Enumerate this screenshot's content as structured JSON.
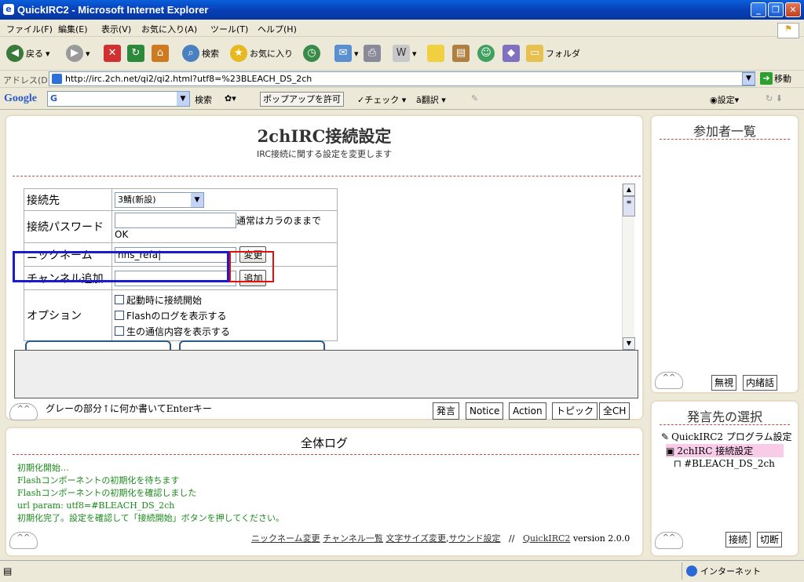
{
  "window": {
    "title": "QuickIRC2 - Microsoft Internet Explorer"
  },
  "menu": [
    "ファイル(F)",
    "編集(E)",
    "表示(V)",
    "お気に入り(A)",
    "ツール(T)",
    "ヘルプ(H)"
  ],
  "toolbar": {
    "back": "戻る",
    "search": "検索",
    "favorites": "お気に入り",
    "folder": "フォルダ"
  },
  "address": {
    "label": "アドレス(D)",
    "url": "http://irc.2ch.net/qi2/qi2.html?utf8=%23BLEACH_DS_2ch",
    "go": "移動"
  },
  "google": {
    "logo": "Google",
    "search_prefix": "G",
    "search_btn": "検索",
    "popup": "ポップアップを許可",
    "check": "チェック",
    "translate": "翻訳",
    "settings": "設定"
  },
  "config": {
    "title": "2chIRC接続設定",
    "subtitle": "IRC接続に関する設定を変更します",
    "server_label": "接続先",
    "server_value": "3鯖(新設)",
    "password_label": "接続パスワード",
    "password_note": "通常はカラのままでOK",
    "nick_label": "ニックネーム",
    "nick_value": "nns_refa|",
    "nick_button": "変更",
    "channel_label": "チャンネル追加",
    "channel_value": "",
    "channel_button": "追加",
    "option_label": "オプション",
    "options": [
      "起動時に接続開始",
      "Flashのログを表示する",
      "生の通信内容を表示する"
    ]
  },
  "input": {
    "hint": "グレーの部分↑に何か書いてEnterキー"
  },
  "actions": [
    "発言",
    "Notice",
    "Action",
    "トピック",
    "全CH"
  ],
  "log": {
    "title": "全体ログ",
    "lines": [
      "初期化開始…",
      "Flashコンポーネントの初期化を待ちます",
      "Flashコンポーネントの初期化を確認しました",
      "url param: utf8=#BLEACH_DS_2ch",
      "初期化完了。設定を確認して「接続開始」ボタンを押してください。"
    ],
    "links": [
      "ニックネーム変更",
      "チャンネル一覧",
      "文字サイズ変更",
      "サウンド設定"
    ],
    "separator": "//",
    "app_link": "QuickIRC2",
    "version": "version 2.0.0"
  },
  "members": {
    "title": "参加者一覧",
    "ignore": "無視",
    "whisper": "内緒話"
  },
  "target": {
    "title": "発言先の選択",
    "items": [
      "QuickIRC2 プログラム設定",
      "2chIRC 接続設定",
      "#BLEACH_DS_2ch"
    ],
    "connect": "接続",
    "disconnect": "切断"
  },
  "status": {
    "zone": "インターネット"
  },
  "face_glyph": "^^",
  "colors": {
    "log_text": "#1a8a1a",
    "selection_bg": "#f8cce8",
    "highlight_blue": "#1a1ad0",
    "highlight_red": "#e01010"
  }
}
